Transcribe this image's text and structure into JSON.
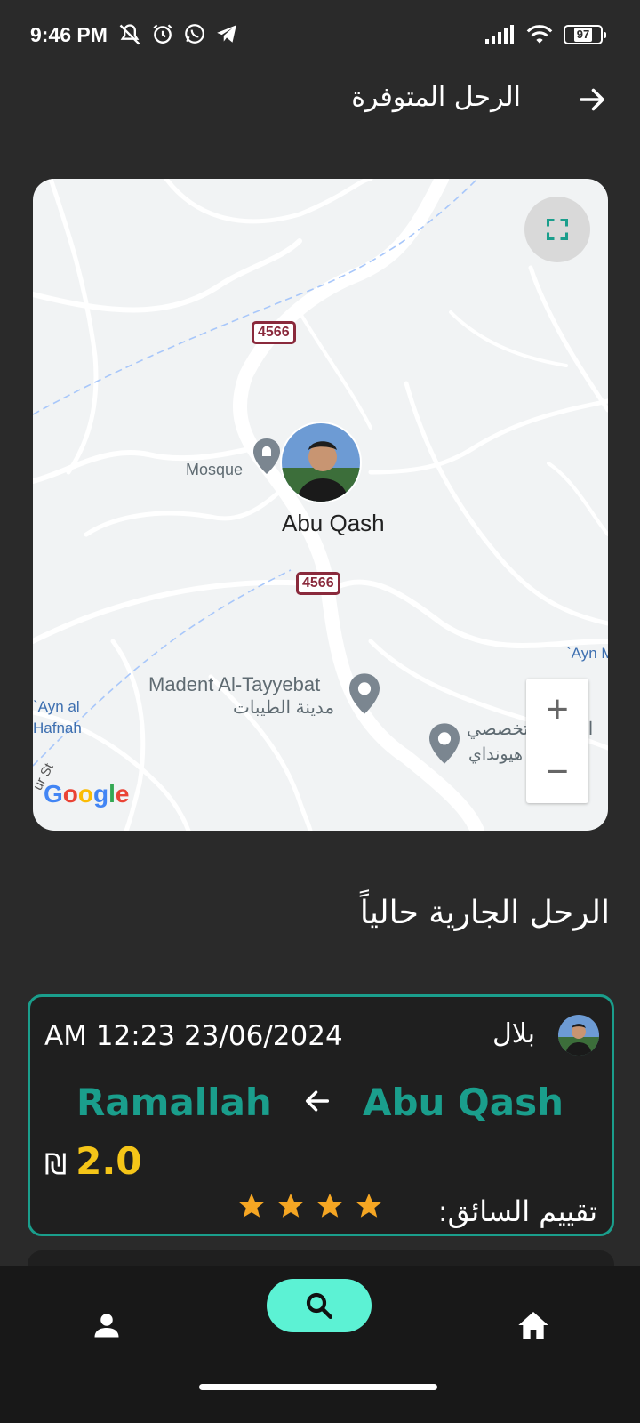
{
  "status_bar": {
    "time": "9:46 PM",
    "battery": "97",
    "icons_left": [
      "mute-icon",
      "alarm-icon",
      "whatsapp-icon",
      "telegram-icon"
    ],
    "icons_right": [
      "signal-icon",
      "wifi-icon",
      "battery-icon"
    ]
  },
  "header": {
    "title": "الرحل المتوفرة",
    "back_icon": "arrow-right-icon"
  },
  "map": {
    "place_name": "Abu Qash",
    "poi_mosque": "Mosque",
    "poi_madent_en": "Madent Al-Tayyebat",
    "poi_madent_ar": "مدينة الطيبات",
    "poi_center_ar_1": "المركز التخصصي",
    "poi_center_ar_2": "هيونداي - Kia...",
    "poi_ayn_al": "`Ayn al",
    "poi_hafnah": "Hafnah",
    "poi_ayn_right": "`Ayn M",
    "road_number_1": "4566",
    "road_number_2": "4566",
    "street_fragment": "ur St",
    "zoom_in": "+",
    "zoom_out": "−",
    "attribution": "Google",
    "fullscreen_icon": "fullscreen-icon"
  },
  "section": {
    "title": "الرحل الجارية حالياً"
  },
  "trip": {
    "driver_name": "بلال",
    "datetime": "AM 12:23 23/06/2024",
    "from_city": "Abu Qash",
    "to_city": "Ramallah",
    "price_value": "2.0",
    "currency": "₪",
    "rating_label": "تقييم السائق:",
    "rating": 4,
    "rating_max": 4,
    "accent_color": "#1a9e8c",
    "price_color": "#f5c518",
    "star_color": "#f5a623"
  },
  "bottom_nav": {
    "items": [
      {
        "name": "profile",
        "icon": "person-icon"
      },
      {
        "name": "search",
        "icon": "search-icon",
        "active": true
      },
      {
        "name": "home",
        "icon": "home-icon"
      }
    ],
    "active_color": "#5cf2d4"
  }
}
